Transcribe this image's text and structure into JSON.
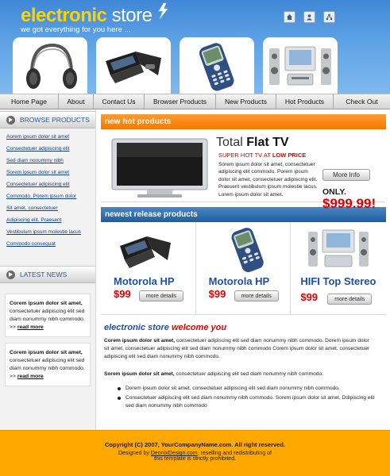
{
  "brand": {
    "logo_part1": "electronic",
    "logo_part2": "store",
    "tagline": "we got everything for you here ..."
  },
  "header_icons": [
    "home-icon",
    "user-icon",
    "sitemap-icon"
  ],
  "nav": [
    "Home Page",
    "About",
    "Contact Us",
    "Browser Products",
    "New Products",
    "Hot Products",
    "Check Out"
  ],
  "sidebar": {
    "browse_title": "BROWSE PRODUCTS",
    "browse_links": [
      "Aorem ipsum dolor sit amet",
      "Consectetuer adipiscing elit",
      "Sed diam nonummy nibh",
      "Sorem ipsum dolor sit amet",
      "Consectetuer adipiscing elit",
      "Commodo. Porem ipsum dolor",
      "Sit amet, consectetuer",
      "Adipiscing elit. Praesent",
      "Vestibulum ipsum molestie lacus",
      "Commodo consequat"
    ],
    "news_title": "LATEST NEWS",
    "news": [
      {
        "bold": "Corem ipsum dolor sit amet,",
        "text": "consectetuer adipiscing elit sed diam nonummy nibh commodo.",
        "more": "read more"
      },
      {
        "bold": "Corem ipsum dolor sit amet,",
        "text": "consectetuer adipiscing elit sed diam nonummy nibh commodo.",
        "more": "read more"
      }
    ]
  },
  "hot": {
    "heading": "new hot products",
    "title_light": "Total",
    "title_bold": "Flat TV",
    "sub_red": "SUPER HOT TV AT",
    "sub_bold": "LOW PRICE",
    "desc": "Sorem ipsum dolor sit amet, consectetuer adipiscing elit commodo. Porem ipsum dolor sit amet, consectetuer adipiscing elit. Praesent vestibulum ipsum molestie lacus. Lorem ipsum dolor sit amet.",
    "button": "More Info",
    "only": "ONLY.",
    "price": "$999.99!"
  },
  "newest": {
    "heading": "newest release products",
    "button": "more details",
    "items": [
      {
        "name": "Motorola HP",
        "price": "$99",
        "image": "flip-phone"
      },
      {
        "name": "Motorola HP",
        "price": "$99",
        "image": "mobile-phone"
      },
      {
        "name": "HIFI Top Stereo",
        "price": "$99",
        "image": "stereo"
      }
    ]
  },
  "welcome": {
    "title_blue": "electronic store",
    "title_red": "welcome you",
    "p1_bold": "Corem ipsum dolor sit amet,",
    "p1": "consectetuer adipiscing elit sed diam nonummy nibh commodo. Dorem ipsum dolor sit amet, consectetuer adipiscing elit sed diam nonummy nibh commodo Corem ipsum dolor sit amet, consectetuer adipiscing elit sed diam nonummy nibh commodo.",
    "p2_bold": "Sorem ipsum dolor sit amet,",
    "p2": "consectetuer adipiscing elit sed diam nonummy nibh commodo.",
    "bullets": [
      "Dorem ipsum dolor sit amet, consectetuer adipiscing elit sed diam nonummy nibh commodo.",
      "Consectetuer adipiscing elit sed diam nonummy nibh commodo. Sorem ipsum dolor sit amet, Ddipiscing elit sed diam nonummy nibh commodo"
    ]
  },
  "footer": {
    "copyright": "Copyright (C) 2007, YourCompanyName.com. All right reserved.",
    "designed_prefix": "Designed by",
    "designed_link": "DeonixDesign.com",
    "designed_suffix": ", reselling and redistributing of",
    "last": "this template is strictly prohibited."
  },
  "colors": {
    "header_blue": "#4f96de",
    "logo_yellow": "#ffd200",
    "accent_orange": "#f37a00",
    "section_blue": "#1f5d9c",
    "price_red": "#e00000",
    "footer_orange": "#ffa800"
  }
}
